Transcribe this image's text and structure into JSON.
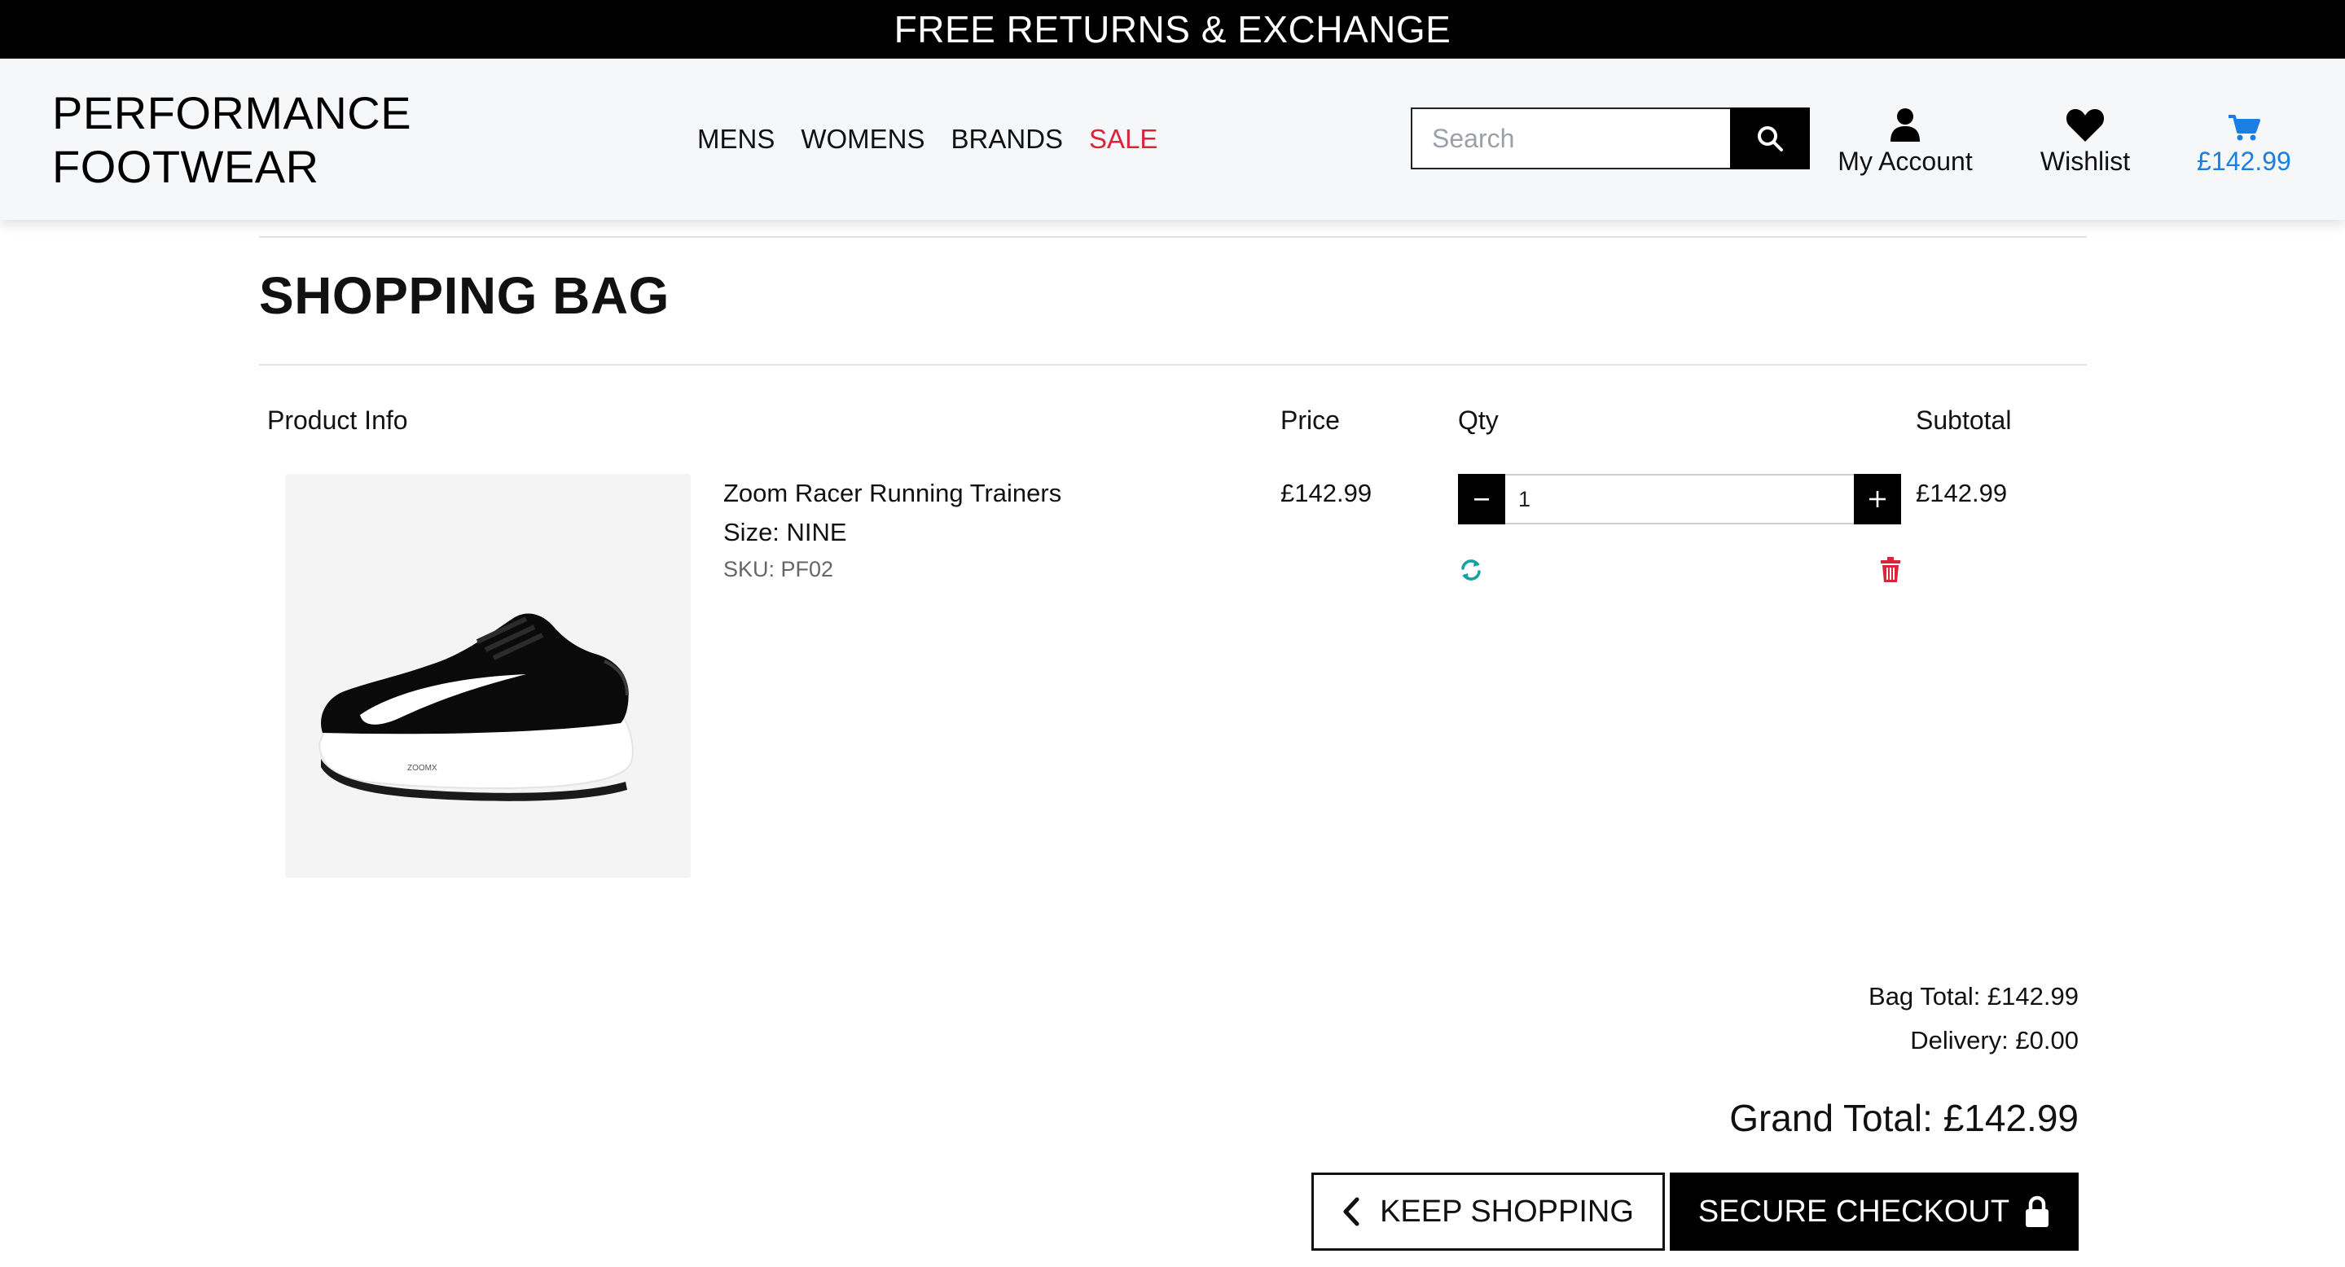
{
  "banner": {
    "text": "FREE RETURNS & EXCHANGE"
  },
  "header": {
    "logo_line1": "PERFORMANCE",
    "logo_line2": "FOOTWEAR",
    "nav": [
      {
        "label": "MENS"
      },
      {
        "label": "WOMENS"
      },
      {
        "label": "BRANDS"
      },
      {
        "label": "SALE",
        "color": "#d9253c"
      }
    ],
    "search": {
      "placeholder": "Search",
      "icon": "search-icon"
    },
    "account": {
      "label": "My Account",
      "icon": "user-icon"
    },
    "wishlist": {
      "label": "Wishlist",
      "icon": "heart-icon"
    },
    "bag": {
      "total": "£142.99",
      "icon": "cart-icon",
      "color": "#1a7fe0"
    }
  },
  "main": {
    "title": "SHOPPING BAG",
    "columns": {
      "product_info": "Product Info",
      "price": "Price",
      "qty": "Qty",
      "subtotal": "Subtotal"
    },
    "items": [
      {
        "name": "Zoom Racer Running Trainers",
        "size": "Size: NINE",
        "sku": "SKU: PF02",
        "price": "£142.99",
        "qty": "1",
        "subtotal": "£142.99",
        "image": "running-shoe-image"
      }
    ],
    "bag_total": "Bag Total: £142.99",
    "delivery": "Delivery: £0.00",
    "grand_total": "Grand Total: £142.99",
    "keep_shopping": "KEEP SHOPPING",
    "secure_checkout": "SECURE CHECKOUT",
    "colors": {
      "update": "#17a2a2",
      "remove": "#d9253c"
    }
  }
}
